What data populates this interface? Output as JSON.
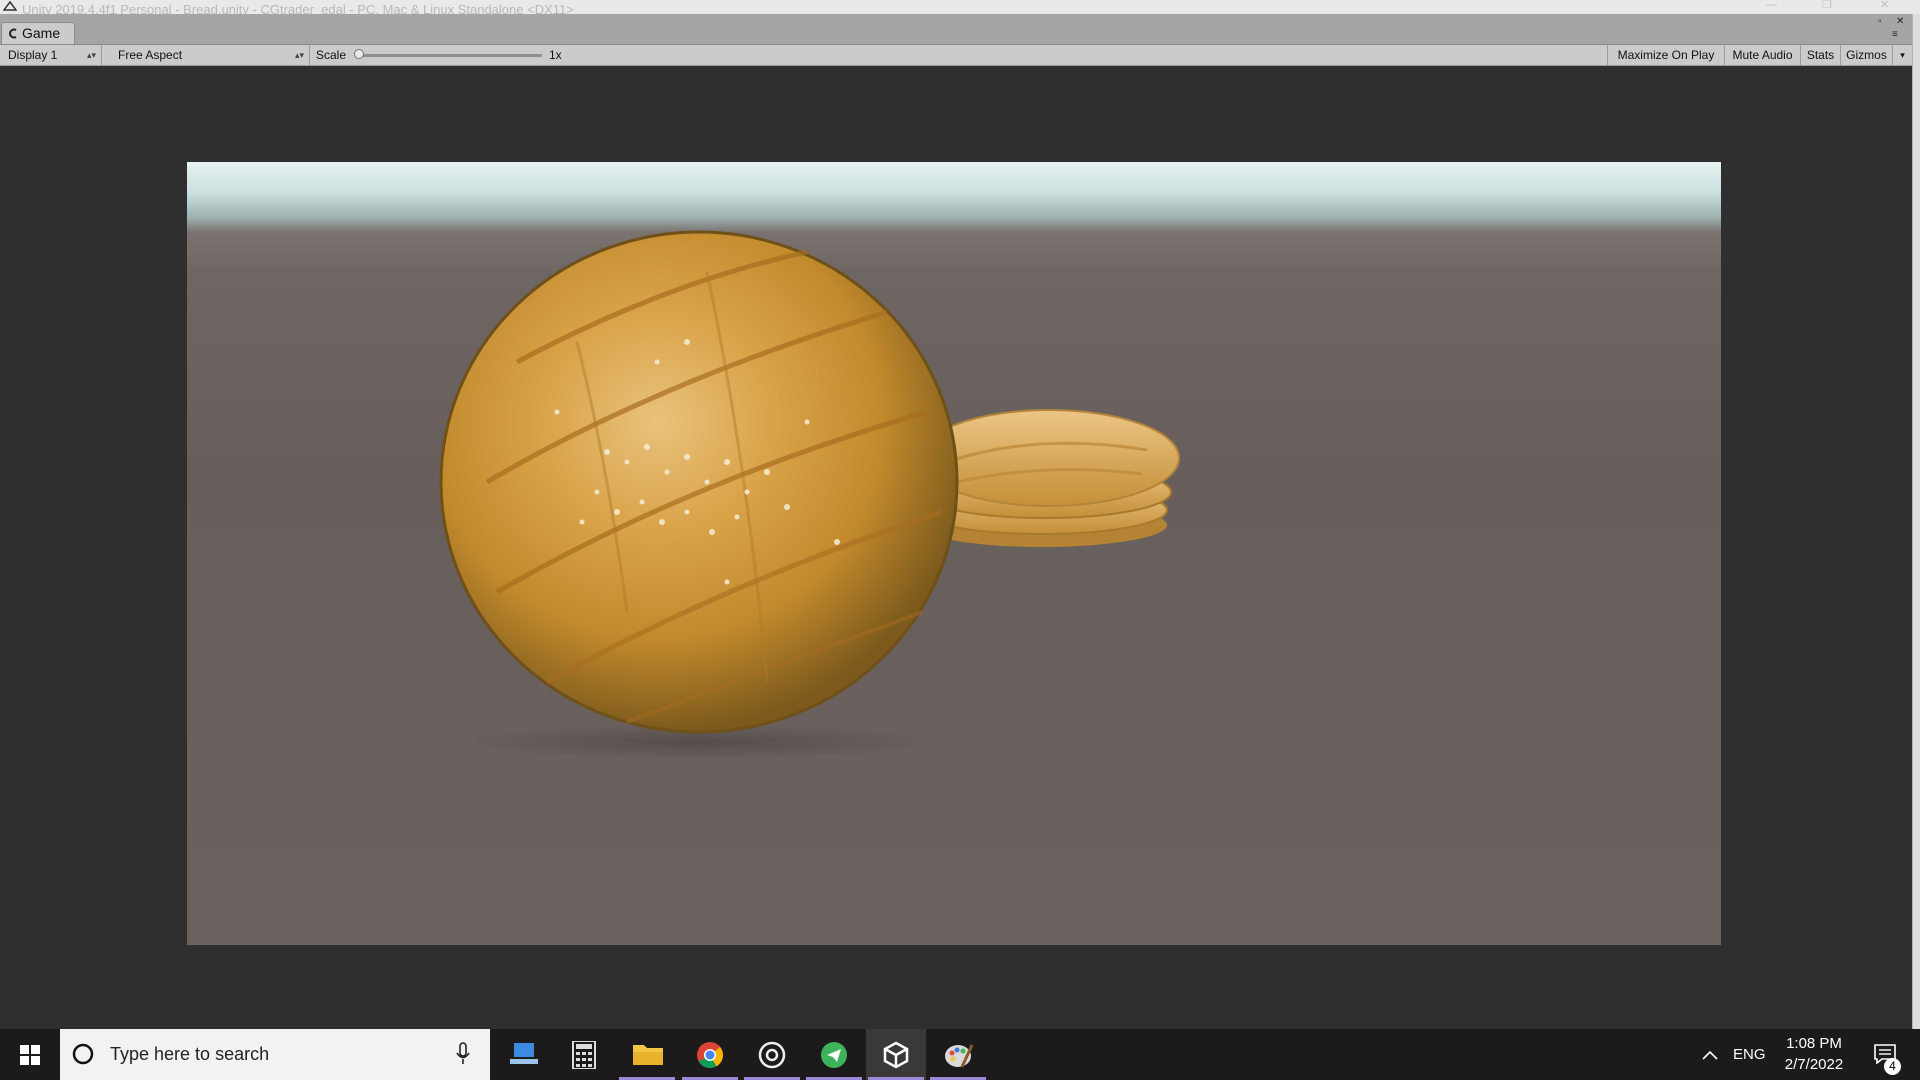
{
  "titlebar": {
    "title": "Unity 2019.4.4f1 Personal - Bread.unity - CGtrader_edal - PC, Mac & Linux Standalone <DX11>"
  },
  "tabs": [
    {
      "label": "Game",
      "icon": "game-controller-icon"
    }
  ],
  "toolbar": {
    "display": "Display 1",
    "aspect": "Free Aspect",
    "scale_label": "Scale",
    "scale_value": "1x",
    "scale_level": 0.0,
    "maximize_on_play": "Maximize On Play",
    "mute_audio": "Mute Audio",
    "stats": "Stats",
    "gizmos": "Gizmos"
  },
  "scene": {
    "objects": [
      "round-bread-loaf",
      "stacked-flatbreads"
    ],
    "colors": {
      "sky": "#e6f2f2",
      "ground": "#6a625e",
      "bread_crust": "#c9932e",
      "bread_highlight": "#e8c27a"
    }
  },
  "taskbar": {
    "search_placeholder": "Type here to search",
    "apps": [
      {
        "name": "remote-desktop-icon",
        "active": false
      },
      {
        "name": "calculator-icon",
        "active": false
      },
      {
        "name": "file-explorer-icon",
        "active": false
      },
      {
        "name": "chrome-icon",
        "active": false
      },
      {
        "name": "media-player-icon",
        "active": false
      },
      {
        "name": "telegram-like-icon",
        "active": false
      },
      {
        "name": "unity-icon",
        "active": true
      },
      {
        "name": "paint-icon",
        "active": false
      }
    ],
    "language": "ENG",
    "time": "1:08 PM",
    "date": "2/7/2022",
    "notification_count": "4"
  }
}
